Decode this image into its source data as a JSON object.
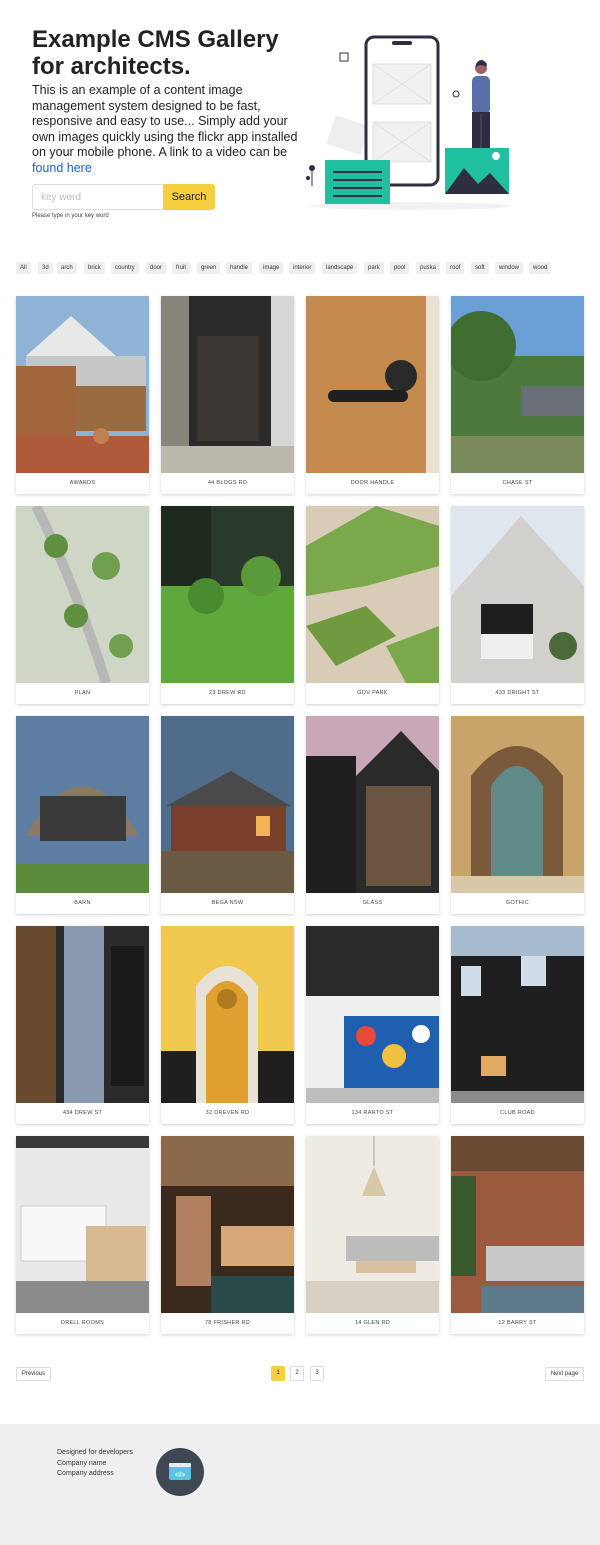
{
  "hero": {
    "title": "Example CMS Gallery for architects.",
    "text": "This is an example of a content image management system designed to be fast, responsive and easy to use... Simply add your own images quickly using the flickr app installed on your mobile phone. A link to a video can be",
    "link_text": "found here",
    "search_placeholder": "key word",
    "search_button": "Search",
    "search_hint": "Please type in your key word"
  },
  "tags": [
    "All",
    "3d",
    "arch",
    "brick",
    "country",
    "door",
    "fruit",
    "green",
    "handle",
    "image",
    "interior",
    "landscape",
    "park",
    "pool",
    "puska",
    "roof",
    "soft",
    "window",
    "wood"
  ],
  "gallery": [
    {
      "caption": "AWARDS"
    },
    {
      "caption": "44 BLOGS RD"
    },
    {
      "caption": "DOOR HANDLE"
    },
    {
      "caption": "CHASE ST"
    },
    {
      "caption": "PLAN"
    },
    {
      "caption": "23 DREW RD"
    },
    {
      "caption": "GOV PARK"
    },
    {
      "caption": "433 DRIGHT ST"
    },
    {
      "caption": "BARN"
    },
    {
      "caption": "BEGA NSW"
    },
    {
      "caption": "GLASS"
    },
    {
      "caption": "GOTHIC"
    },
    {
      "caption": "434 DREW ST"
    },
    {
      "caption": "32 DREVEN RD"
    },
    {
      "caption": "134 RARTO ST"
    },
    {
      "caption": "CLUB ROAD"
    },
    {
      "caption": "DRELL ROOMS"
    },
    {
      "caption": "78 FRISHER RD"
    },
    {
      "caption": "14 GLEN RD"
    },
    {
      "caption": "12 BARRY ST"
    }
  ],
  "pagination": {
    "previous": "Previous",
    "next": "Next page",
    "pages": [
      "1",
      "2",
      "3"
    ],
    "current": "1"
  },
  "footer": {
    "line1": "Designed for developers",
    "line2": "Company name",
    "line3": "Company address",
    "logo_icon": "code-window-icon"
  },
  "colors": {
    "accent": "#f5cf3d",
    "link": "#1a63d8",
    "teal": "#1fbf9f",
    "footer_bg": "#efefef"
  }
}
